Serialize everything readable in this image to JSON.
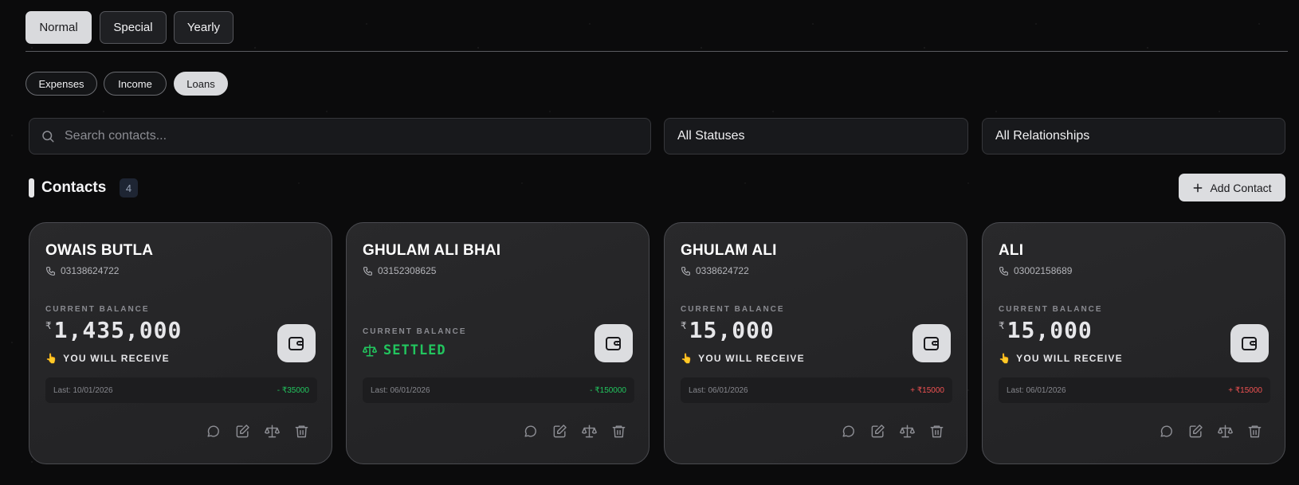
{
  "tabs": [
    "Normal",
    "Special",
    "Yearly"
  ],
  "subtabs": [
    "Expenses",
    "Income",
    "Loans"
  ],
  "filters": {
    "search_placeholder": "Search contacts...",
    "status": "All Statuses",
    "relationship": "All Relationships"
  },
  "contacts_section": {
    "title": "Contacts",
    "count": "4",
    "add_label": "Add Contact"
  },
  "balance_label": "CURRENT BALANCE",
  "currency_symbol": "₹",
  "colors": {
    "accent_positive": "#22c55e",
    "accent_negative": "#f05252"
  },
  "cards": [
    {
      "name": "OWAIS BUTLA",
      "phone": "03138624722",
      "amount": "1,435,000",
      "status": "YOU WILL RECEIVE",
      "last": "Last: 10/01/2026",
      "change": "- ₹35000"
    },
    {
      "name": "GHULAM ALI BHAI",
      "phone": "03152308625",
      "status": "SETTLED",
      "last": "Last: 06/01/2026",
      "change": "- ₹150000"
    },
    {
      "name": "GHULAM ALI",
      "phone": "0338624722",
      "amount": "15,000",
      "status": "YOU WILL RECEIVE",
      "last": "Last: 06/01/2026",
      "change": "+ ₹15000"
    },
    {
      "name": "ALI",
      "phone": "03002158689",
      "amount": "15,000",
      "status": "YOU WILL RECEIVE",
      "last": "Last: 06/01/2026",
      "change": "+ ₹15000"
    }
  ]
}
